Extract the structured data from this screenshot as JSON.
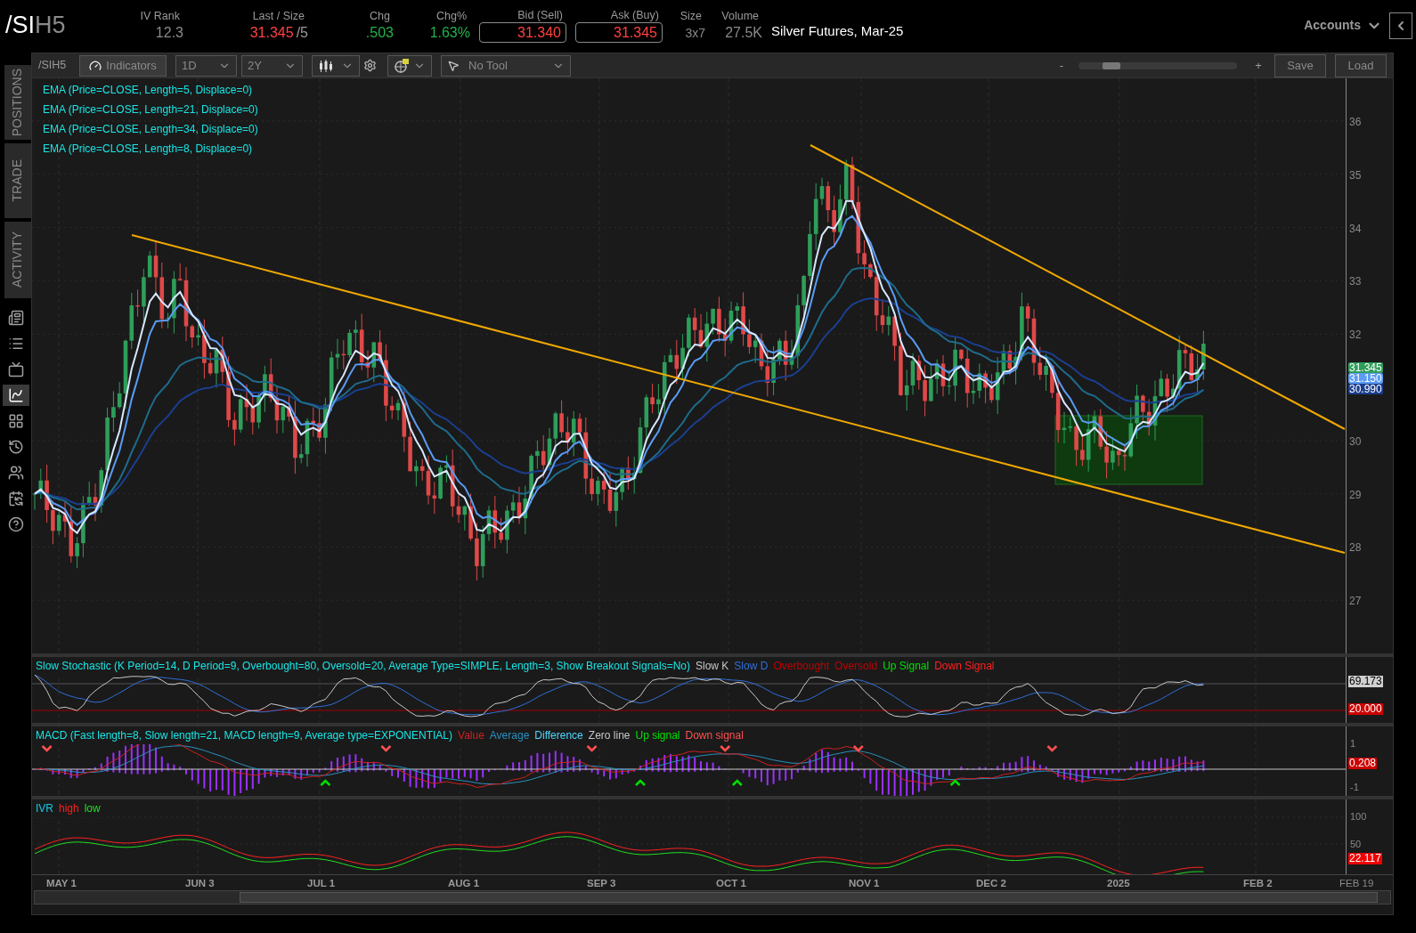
{
  "header": {
    "symbol_root": "/SI",
    "symbol_suffix": "H5",
    "quote_fields": [
      {
        "label": "IV Rank",
        "value": "12.3",
        "kind": "plain"
      },
      {
        "label": "Last / Size",
        "value": "31.345",
        "size": "/5",
        "kind": "last"
      },
      {
        "label": "Chg",
        "value": ".503",
        "kind": "up"
      },
      {
        "label": "Chg%",
        "value": "1.63%",
        "kind": "up"
      },
      {
        "label": "Bid (Sell)",
        "value": "31.340",
        "kind": "boxed"
      },
      {
        "label": "Ask (Buy)",
        "value": "31.345",
        "kind": "boxed"
      },
      {
        "label": "Size",
        "value": "3x7",
        "kind": "small"
      },
      {
        "label": "Volume",
        "value": "27.5K",
        "kind": "plain"
      }
    ],
    "description": "Silver Futures, Mar-25",
    "accounts_menu": "Accounts"
  },
  "sidebar": {
    "tabs": [
      "POSITIONS",
      "TRADE",
      "ACTIVITY"
    ],
    "icon_buttons": [
      {
        "selected": false
      },
      {
        "selected": false
      },
      {
        "selected": false
      },
      {
        "selected": true
      },
      {
        "selected": false
      },
      {
        "selected": false
      },
      {
        "selected": false
      },
      {
        "selected": false
      },
      {
        "selected": false
      }
    ]
  },
  "toolbar": {
    "symbol": "/SIH5",
    "indicators_button": "Indicators",
    "aggregation": "1D",
    "time_frame": "2Y",
    "drawing_tool": "No Tool",
    "zoom_out": "-",
    "zoom_in": "+",
    "zoom_slider": {
      "level": 0.15
    },
    "save_button": "Save",
    "load_button": "Load"
  },
  "price_chart": {
    "studies": [
      "EMA (Price=CLOSE, Length=5, Displace=0)",
      "EMA (Price=CLOSE, Length=21, Displace=0)",
      "EMA (Price=CLOSE, Length=34, Displace=0)",
      "EMA (Price=CLOSE, Length=8, Displace=0)"
    ],
    "price_axis": [
      "36",
      "35",
      "34",
      "33",
      "32",
      "30",
      "29",
      "28",
      "27"
    ],
    "price_badges": [
      {
        "value": "31.345",
        "color": "#2e9e5a"
      },
      {
        "value": "31.150",
        "color": "#5b9cf5"
      },
      {
        "value": "30.990",
        "color": "#1a3f8f"
      }
    ]
  },
  "stochastic": {
    "title": "Slow Stochastic (K Period=14, D Period=9, Overbought=80, Oversold=20, Average Type=SIMPLE, Length=3, Show Breakout Signals=No)",
    "legend": [
      {
        "label": "Slow K",
        "color": "#c8c8c8"
      },
      {
        "label": "Slow D",
        "color": "#2f6fd8"
      },
      {
        "label": "Overbought",
        "color": "#c00000"
      },
      {
        "label": "Oversold",
        "color": "#c00000"
      },
      {
        "label": "Up Signal",
        "color": "#00e000"
      },
      {
        "label": "Down Signal",
        "color": "#ff2020"
      }
    ],
    "badges": [
      {
        "value": "69.173",
        "color": "#d0d0d0"
      },
      {
        "value": "20.000",
        "color": "#cc0000"
      }
    ]
  },
  "macd": {
    "title": "MACD (Fast length=8, Slow length=21, MACD length=9, Average type=EXPONENTIAL)",
    "legend": [
      {
        "label": "Value",
        "color": "#d02020"
      },
      {
        "label": "Average",
        "color": "#2a8fc0"
      },
      {
        "label": "Difference",
        "color": "#4fd8ff"
      },
      {
        "label": "Zero line",
        "color": "#c8c8c8"
      },
      {
        "label": "Up signal",
        "color": "#00e000"
      },
      {
        "label": "Down signal",
        "color": "#ff5050"
      }
    ],
    "axis": [
      "1",
      "-1"
    ],
    "badge": "0.208"
  },
  "ivr": {
    "title": "IVR",
    "legend": [
      {
        "label": "high",
        "color": "#ff2020"
      },
      {
        "label": "low",
        "color": "#20e020"
      }
    ],
    "axis": [
      "100",
      "50"
    ],
    "badge": "22.117"
  },
  "time_axis": [
    "MAY 1",
    "JUN 3",
    "JUL 1",
    "AUG 1",
    "SEP 3",
    "OCT 1",
    "NOV 1",
    "DEC 2",
    "2025",
    "FEB 2",
    "FEB 19"
  ]
}
